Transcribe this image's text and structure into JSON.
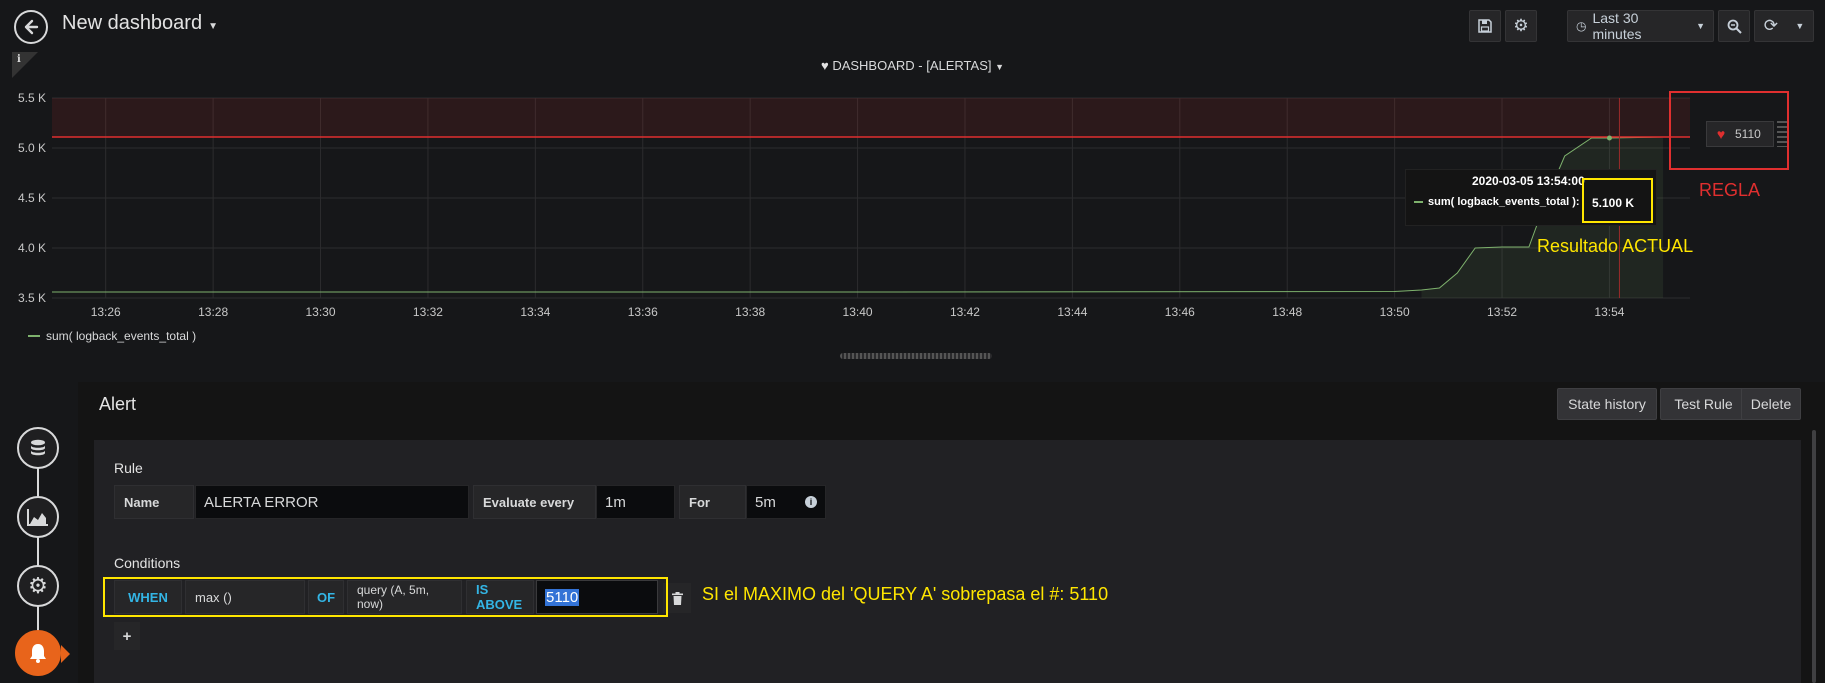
{
  "header": {
    "back_icon": "arrow-left-icon",
    "title": "New dashboard",
    "save_icon": "save-icon",
    "settings_icon": "gear-icon",
    "time_range": "Last 30 minutes",
    "zoom_icon": "zoom-out-icon",
    "refresh_icon": "refresh-icon"
  },
  "panel": {
    "title": "DASHBOARD - [ALERTAS]",
    "status_icon": "heart-icon",
    "info_icon": "info-icon"
  },
  "chart_data": {
    "type": "line",
    "title": "DASHBOARD - [ALERTAS]",
    "ylim": [
      3500,
      5500
    ],
    "y_ticks": [
      "3.5 K",
      "4.0 K",
      "4.5 K",
      "5.0 K",
      "5.5 K"
    ],
    "y_tick_values": [
      3500,
      4000,
      4500,
      5000,
      5500
    ],
    "x_ticks": [
      "13:26",
      "13:28",
      "13:30",
      "13:32",
      "13:34",
      "13:36",
      "13:38",
      "13:40",
      "13:42",
      "13:44",
      "13:46",
      "13:48",
      "13:50",
      "13:52",
      "13:54"
    ],
    "x_range": [
      "13:25",
      "13:55:30"
    ],
    "series": [
      {
        "name": "sum( logback_events_total )",
        "color": "#7eb26d",
        "x": [
          "13:25",
          "13:40",
          "13:50",
          "13:50:30",
          "13:50:50",
          "13:51:10",
          "13:51:30",
          "13:52:00",
          "13:52:30",
          "13:52:50",
          "13:53:10",
          "13:53:40",
          "13:54:00",
          "13:55:00"
        ],
        "y": [
          3560,
          3560,
          3565,
          3580,
          3600,
          3750,
          4000,
          4010,
          4010,
          4500,
          4920,
          5100,
          5100,
          5110
        ]
      }
    ],
    "threshold": {
      "value": 5110,
      "color": "#e02f2f",
      "op": "gt"
    },
    "grid": true,
    "legend": "bottom-left"
  },
  "tooltip": {
    "time": "2020-03-05 13:54:00",
    "series": "sum( logback_events_total ):",
    "value": "5.100 K"
  },
  "threshold_handle": {
    "icon": "broken-heart-icon",
    "value": "5110"
  },
  "annotations": {
    "regla": "REGLA",
    "resultado": "Resultado ACTUAL",
    "condition_note": "SI el MAXIMO del 'QUERY A' sobrepasa el #:  5110"
  },
  "alert": {
    "title": "Alert",
    "buttons": {
      "state_history": "State history",
      "test_rule": "Test Rule",
      "delete": "Delete"
    },
    "rule": {
      "section": "Rule",
      "name_label": "Name",
      "name_value": "ALERTA ERROR",
      "evaluate_label": "Evaluate every",
      "evaluate_value": "1m",
      "for_label": "For",
      "for_value": "5m"
    },
    "conditions": {
      "section": "Conditions",
      "when": "WHEN",
      "reducer": "max ()",
      "of": "OF",
      "query": "query (A, 5m, now)",
      "evaluator": "IS ABOVE",
      "threshold": "5110",
      "add": "+"
    }
  },
  "sidenav": {
    "items": [
      "database-icon",
      "area-chart-icon",
      "gear-wrench-icon",
      "bell-icon"
    ],
    "active_color": "#e8641b"
  }
}
